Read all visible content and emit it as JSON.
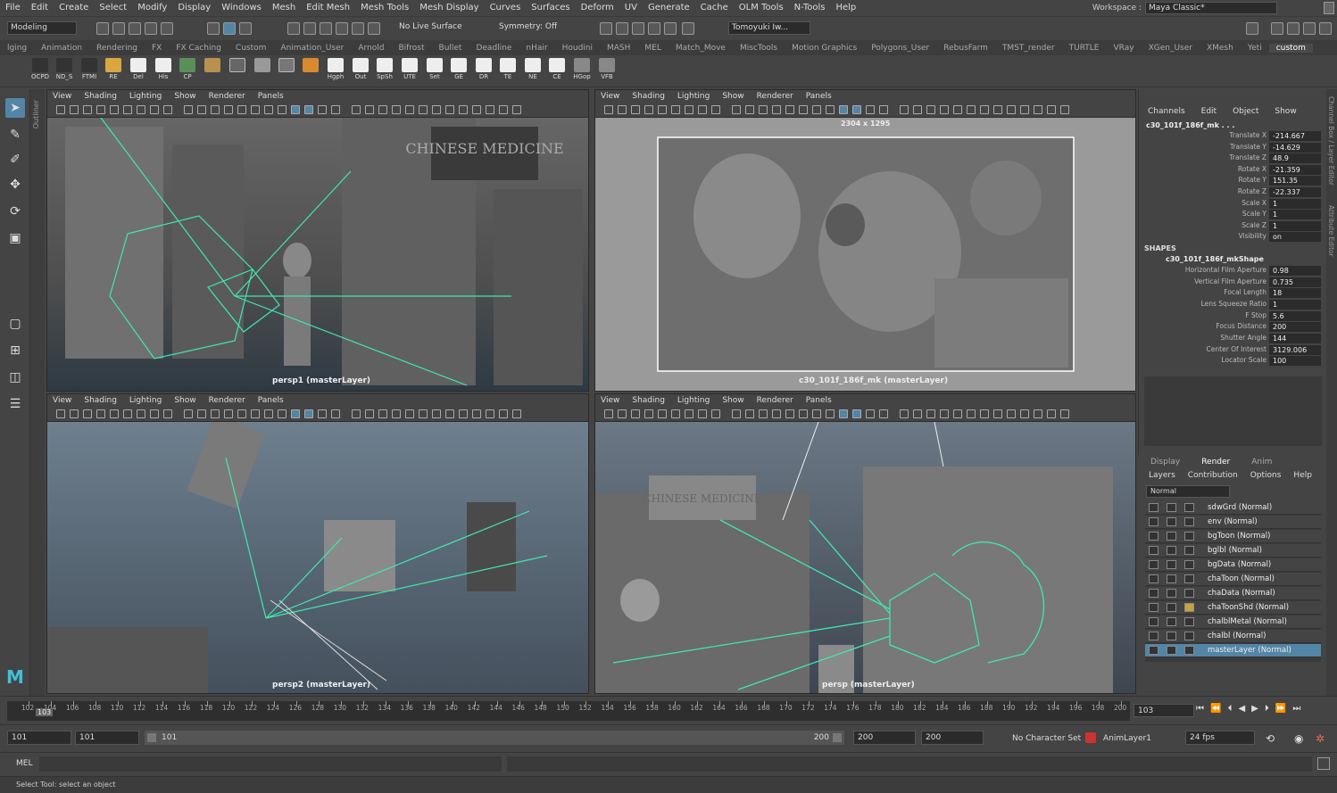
{
  "menubar": [
    "File",
    "Edit",
    "Create",
    "Select",
    "Modify",
    "Display",
    "Windows",
    "Mesh",
    "Edit Mesh",
    "Mesh Tools",
    "Mesh Display",
    "Curves",
    "Surfaces",
    "Deform",
    "UV",
    "Generate",
    "Cache",
    "OLM Tools",
    "N-Tools",
    "Help"
  ],
  "workspace": {
    "label": "Workspace :",
    "value": "Maya Classic*"
  },
  "statusline": {
    "mode": "Modeling",
    "live_surface": "No Live Surface",
    "symmetry": "Symmetry: Off",
    "user": "Tomoyuki Iw..."
  },
  "shelf_tabs": [
    "lging",
    "Animation",
    "Rendering",
    "FX",
    "FX Caching",
    "Custom",
    "Animation_User",
    "Arnold",
    "Bifrost",
    "Bullet",
    "Deadline",
    "nHair",
    "Houdini",
    "MASH",
    "MEL",
    "Match_Move",
    "MiscTools",
    "Motion Graphics",
    "Polygons_User",
    "RebusFarm",
    "TMST_render",
    "TURTLE",
    "VRay",
    "XGen_User",
    "XMesh",
    "Yeti",
    "custom"
  ],
  "shelf_items": [
    "OCPD",
    "ND_S",
    "FTMI",
    "RE",
    "Del",
    "His",
    "CP",
    "",
    "",
    "",
    "",
    "",
    "Hgph",
    "Out",
    "SpSh",
    "UTE",
    "Set",
    "GE",
    "DR",
    "TE",
    "NE",
    "CE",
    "HGop",
    "VFB"
  ],
  "viewport_menu": [
    "View",
    "Shading",
    "Lighting",
    "Show",
    "Renderer",
    "Panels"
  ],
  "viewports": [
    {
      "label": "persp1 (masterLayer)",
      "sign": "CHINESE MEDICINE"
    },
    {
      "label": "c30_101f_186f_mk (masterLayer)",
      "resolution": "2304 x 1295"
    },
    {
      "label": "persp2 (masterLayer)"
    },
    {
      "label": "persp (masterLayer)",
      "sign": "CHINESE MEDICINE"
    }
  ],
  "channel_box": {
    "menu": [
      "Channels",
      "Edit",
      "Object",
      "Show"
    ],
    "object": "c30_101f_186f_mk . . .",
    "transform": [
      {
        "name": "Translate X",
        "value": "-214.667"
      },
      {
        "name": "Translate Y",
        "value": "-14.629"
      },
      {
        "name": "Translate Z",
        "value": "48.9"
      },
      {
        "name": "Rotate X",
        "value": "-21.359"
      },
      {
        "name": "Rotate Y",
        "value": "151.35"
      },
      {
        "name": "Rotate Z",
        "value": "-22.337"
      },
      {
        "name": "Scale X",
        "value": "1"
      },
      {
        "name": "Scale Y",
        "value": "1"
      },
      {
        "name": "Scale Z",
        "value": "1"
      },
      {
        "name": "Visibility",
        "value": "on"
      }
    ],
    "shapes_label": "SHAPES",
    "shape_name": "c30_101f_186f_mkShape",
    "shape_attrs": [
      {
        "name": "Horizontal Film Aperture",
        "value": "0.98"
      },
      {
        "name": "Vertical Film Aperture",
        "value": "0.735"
      },
      {
        "name": "Focal Length",
        "value": "18"
      },
      {
        "name": "Lens Squeeze Ratio",
        "value": "1"
      },
      {
        "name": "F Stop",
        "value": "5.6"
      },
      {
        "name": "Focus Distance",
        "value": "200"
      },
      {
        "name": "Shutter Angle",
        "value": "144"
      },
      {
        "name": "Center Of Interest",
        "value": "3129.006"
      },
      {
        "name": "Locator Scale",
        "value": "100"
      }
    ]
  },
  "side_tab": "Channel Box / Layer Editor",
  "side_tab2": "Attribute Editor",
  "outliner_tab": "Outliner",
  "layer_editor": {
    "tabs": [
      "Display",
      "Render",
      "Anim"
    ],
    "menu": [
      "Layers",
      "Contribution",
      "Options",
      "Help"
    ],
    "mode": "Normal",
    "layers": [
      "sdwGrd (Normal)",
      "env (Normal)",
      "bgToon (Normal)",
      "bglbl (Normal)",
      "bgData (Normal)",
      "chaToon (Normal)",
      "chaData (Normal)",
      "chaToonShd (Normal)",
      "chalblMetal (Normal)",
      "chalbl (Normal)",
      "masterLayer (Normal)"
    ],
    "selected": "masterLayer (Normal)"
  },
  "timeline": {
    "ticks": [
      "102",
      "104",
      "106",
      "108",
      "110",
      "112",
      "114",
      "116",
      "118",
      "120",
      "122",
      "124",
      "126",
      "128",
      "130",
      "132",
      "134",
      "136",
      "138",
      "140",
      "142",
      "144",
      "146",
      "148",
      "150",
      "152",
      "154",
      "156",
      "158",
      "160",
      "162",
      "164",
      "166",
      "168",
      "170",
      "172",
      "174",
      "176",
      "178",
      "180",
      "182",
      "184",
      "186",
      "188",
      "190",
      "192",
      "194",
      "196",
      "198",
      "200"
    ],
    "current_marker": "103",
    "current_frame": "103"
  },
  "range": {
    "start": "101",
    "playback_start": "101",
    "slider_start": "101",
    "slider_end": "200",
    "playback_end": "200",
    "end": "200",
    "character_set": "No Character Set",
    "anim_layer": "AnimLayer1",
    "fps": "24 fps"
  },
  "command": {
    "lang": "MEL"
  },
  "help": "Select Tool: select an object",
  "colors": {
    "accent": "#5285a6",
    "wireframe": "#3fe8b0",
    "bg": "#444444"
  }
}
